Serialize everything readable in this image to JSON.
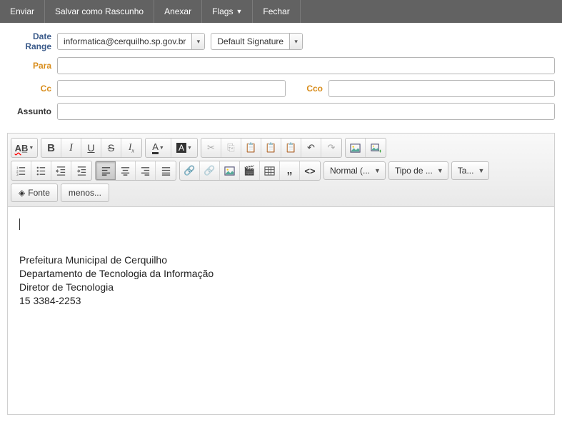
{
  "toolbar": {
    "send": "Enviar",
    "save_draft": "Salvar como Rascunho",
    "attach": "Anexar",
    "flags": "Flags",
    "close": "Fechar"
  },
  "fields": {
    "date_range_label": "Date Range",
    "from_email": "informatica@cerquilho.sp.gov.br",
    "signature": "Default Signature",
    "to_label": "Para",
    "to_value": "",
    "cc_label": "Cc",
    "cc_value": "",
    "bcc_label": "Cco",
    "bcc_value": "",
    "subject_label": "Assunto",
    "subject_value": ""
  },
  "editor_selects": {
    "paragraph": "Normal (...",
    "fontname": "Tipo de ...",
    "fontsize": "Ta..."
  },
  "editor_buttons": {
    "source": "Fonte",
    "less": "menos..."
  },
  "signature": {
    "line1": "Prefeitura Municipal de Cerquilho",
    "line2": "Departamento de Tecnologia da Informação",
    "line3": "Diretor de Tecnologia",
    "line4": "15 3384-2253"
  }
}
